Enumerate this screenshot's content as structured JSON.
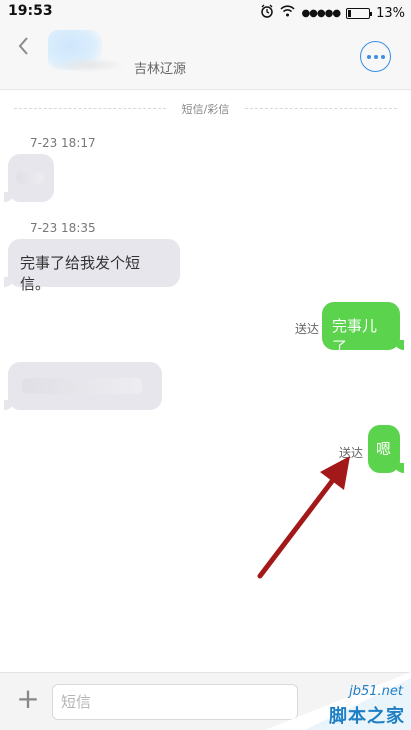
{
  "status_bar": {
    "time": "19:53",
    "signal": "●●●●●",
    "battery": "13%"
  },
  "header": {
    "carrier": "吉林辽源",
    "back_glyph": "<",
    "more_icon": "more-icon"
  },
  "thread": {
    "section_label": "短信/彩信",
    "messages": [
      {
        "time": "7-23 18:17"
      },
      {
        "time": "7-23 18:35",
        "text": "完事了给我发个短信。"
      },
      {
        "text": "完事儿了",
        "status": "送达"
      },
      {
        "text": "嗯",
        "status": "送达"
      }
    ]
  },
  "composer": {
    "placeholder": "短信",
    "plus_glyph": "+"
  },
  "watermark": {
    "site": "jb51.net",
    "name": "脚本之家"
  },
  "colors": {
    "accent": "#3a8ee6",
    "sent_bubble": "#5bd34c",
    "received_bubble": "#e6e6ec",
    "arrow": "#a31818"
  }
}
